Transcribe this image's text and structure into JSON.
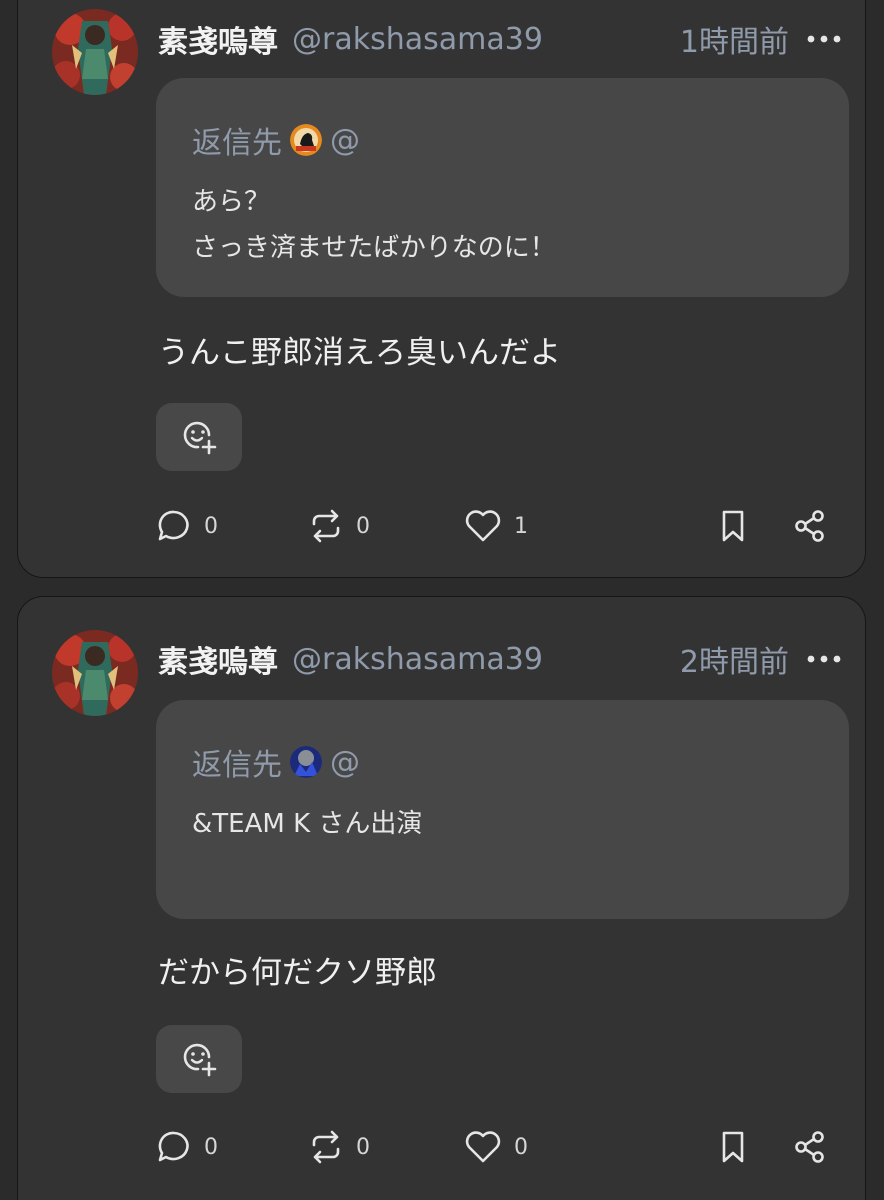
{
  "posts": [
    {
      "display_name": "素戔嗚尊",
      "handle": "@rakshasama39",
      "time": "1時間前",
      "reply_label": "返信先",
      "reply_handle": "@",
      "quote_lines": [
        "あら？",
        "さっき済ませたばかりなのに！"
      ],
      "body": "うんこ野郎消えろ臭いんだよ",
      "counts": {
        "replies": "0",
        "renotes": "0",
        "likes": "1"
      }
    },
    {
      "display_name": "素戔嗚尊",
      "handle": "@rakshasama39",
      "time": "2時間前",
      "reply_label": "返信先",
      "reply_handle": "@",
      "quote_lines": [
        "&TEAM K さん出演"
      ],
      "body": "だから何だクソ野郎",
      "counts": {
        "replies": "0",
        "renotes": "0",
        "likes": "0"
      }
    }
  ],
  "icons": {
    "more": "more-horizontal-icon",
    "reaction": "add-reaction-icon",
    "reply": "reply-icon",
    "renote": "renote-icon",
    "like": "heart-icon",
    "bookmark": "bookmark-icon",
    "share": "share-icon"
  },
  "colors": {
    "background": "#2b2b2b",
    "card": "#333333",
    "quote": "#474747",
    "muted": "#8f9aaa",
    "text": "#f0f0f0"
  }
}
